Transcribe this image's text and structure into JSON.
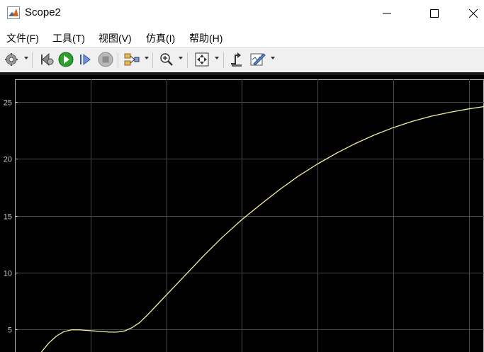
{
  "window": {
    "title": "Scope2",
    "controls": [
      "minimize",
      "maximize",
      "close"
    ]
  },
  "menu": [
    {
      "label": "文件(F)",
      "accel": "F"
    },
    {
      "label": "工具(T)",
      "accel": "T"
    },
    {
      "label": "视图(V)",
      "accel": "V"
    },
    {
      "label": "仿真(I)",
      "accel": "I"
    },
    {
      "label": "帮助(H)",
      "accel": "H"
    }
  ],
  "toolbar": {
    "buttons": [
      {
        "icon": "gear-icon",
        "dropdown": true
      },
      {
        "icon": "step-back-icon"
      },
      {
        "icon": "run-icon",
        "color": "#1f8a1f"
      },
      {
        "icon": "step-forward-icon"
      },
      {
        "icon": "stop-icon"
      },
      {
        "icon": "signal-selector-icon",
        "dropdown": true
      },
      {
        "icon": "zoom-in-icon",
        "dropdown": true
      },
      {
        "icon": "autoscale-icon",
        "dropdown": true
      },
      {
        "icon": "triggers-icon"
      },
      {
        "icon": "edit-style-icon",
        "dropdown": true
      }
    ]
  },
  "chart_data": {
    "type": "line",
    "background": "#000000",
    "grid": true,
    "line_color": "#f5f0a0",
    "ylim": [
      3,
      27
    ],
    "xlim": [
      0,
      6.2
    ],
    "y_tick_labels": [
      "5",
      "10",
      "15",
      "20",
      "25"
    ],
    "y_ticks": [
      5,
      10,
      15,
      20,
      25
    ],
    "x_gridlines": [
      1,
      2,
      3,
      4,
      5,
      6
    ],
    "series": [
      {
        "x": [
          0.35,
          0.45,
          0.55,
          0.65,
          0.75,
          0.85,
          0.95,
          1.05,
          1.15,
          1.25,
          1.35,
          1.45,
          1.55,
          1.65,
          1.75,
          1.9,
          2.1,
          2.3,
          2.5,
          2.75,
          3.0,
          3.25,
          3.5,
          3.75,
          4.0,
          4.25,
          4.5,
          4.75,
          5.0,
          5.25,
          5.5,
          5.75,
          6.0,
          6.2
        ],
        "y": [
          3.0,
          3.8,
          4.4,
          4.8,
          4.95,
          4.95,
          4.9,
          4.85,
          4.8,
          4.75,
          4.75,
          4.85,
          5.15,
          5.6,
          6.25,
          7.3,
          8.7,
          10.1,
          11.5,
          13.15,
          14.65,
          16.0,
          17.3,
          18.5,
          19.55,
          20.5,
          21.35,
          22.1,
          22.75,
          23.3,
          23.75,
          24.1,
          24.4,
          24.6
        ]
      }
    ]
  }
}
